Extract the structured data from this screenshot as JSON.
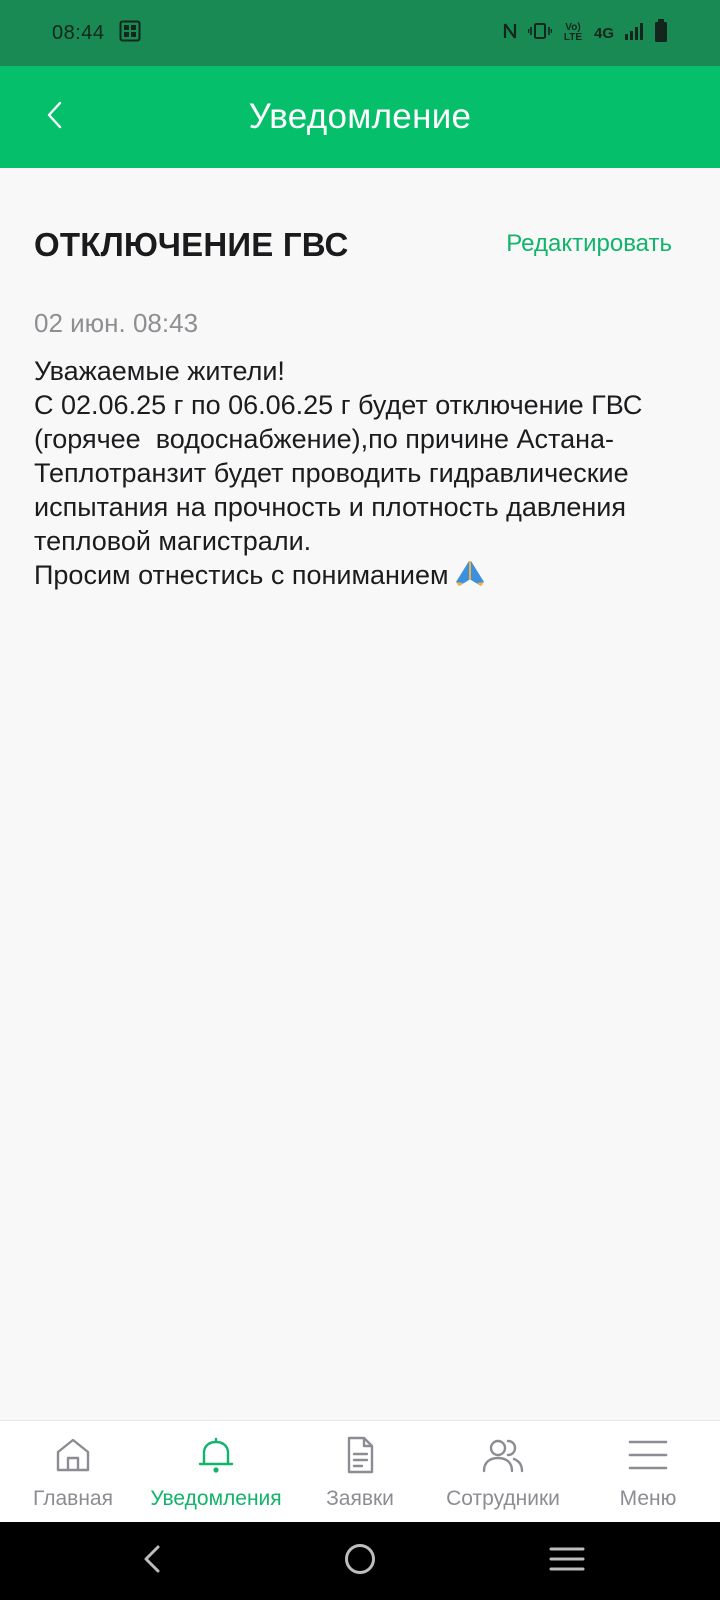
{
  "status_bar": {
    "time": "08:44",
    "volte": "Vo) LTE",
    "network": "4G"
  },
  "header": {
    "title": "Уведомление",
    "back_icon": "chevron-left-icon"
  },
  "notification": {
    "title": "ОТКЛЮЧЕНИЕ ГВС",
    "edit_label": "Редактировать",
    "date": "02 июн. 08:43",
    "body": "Уважаемые жители!\nС 02.06.25 г по 06.06.25 г будет отключение ГВС (горячее  водоснабжение),по причине Астана-Теплотранзит будет проводить гидравлические испытания на прочность и плотность давления тепловой магистрали.\nПросим отнестись с пониманием",
    "emoji": "folded-hands-icon"
  },
  "bottom_nav": {
    "items": [
      {
        "label": "Главная",
        "icon": "home-icon",
        "active": false
      },
      {
        "label": "Уведомления",
        "icon": "bell-icon",
        "active": true
      },
      {
        "label": "Заявки",
        "icon": "document-icon",
        "active": false
      },
      {
        "label": "Сотрудники",
        "icon": "users-icon",
        "active": false
      },
      {
        "label": "Меню",
        "icon": "menu-icon",
        "active": false
      }
    ]
  },
  "colors": {
    "status_bar": "#1a8a55",
    "app_bar": "#06bf6b",
    "accent": "#10b46a",
    "background": "#f8f8f9",
    "nav_inactive": "#8c8c92"
  }
}
